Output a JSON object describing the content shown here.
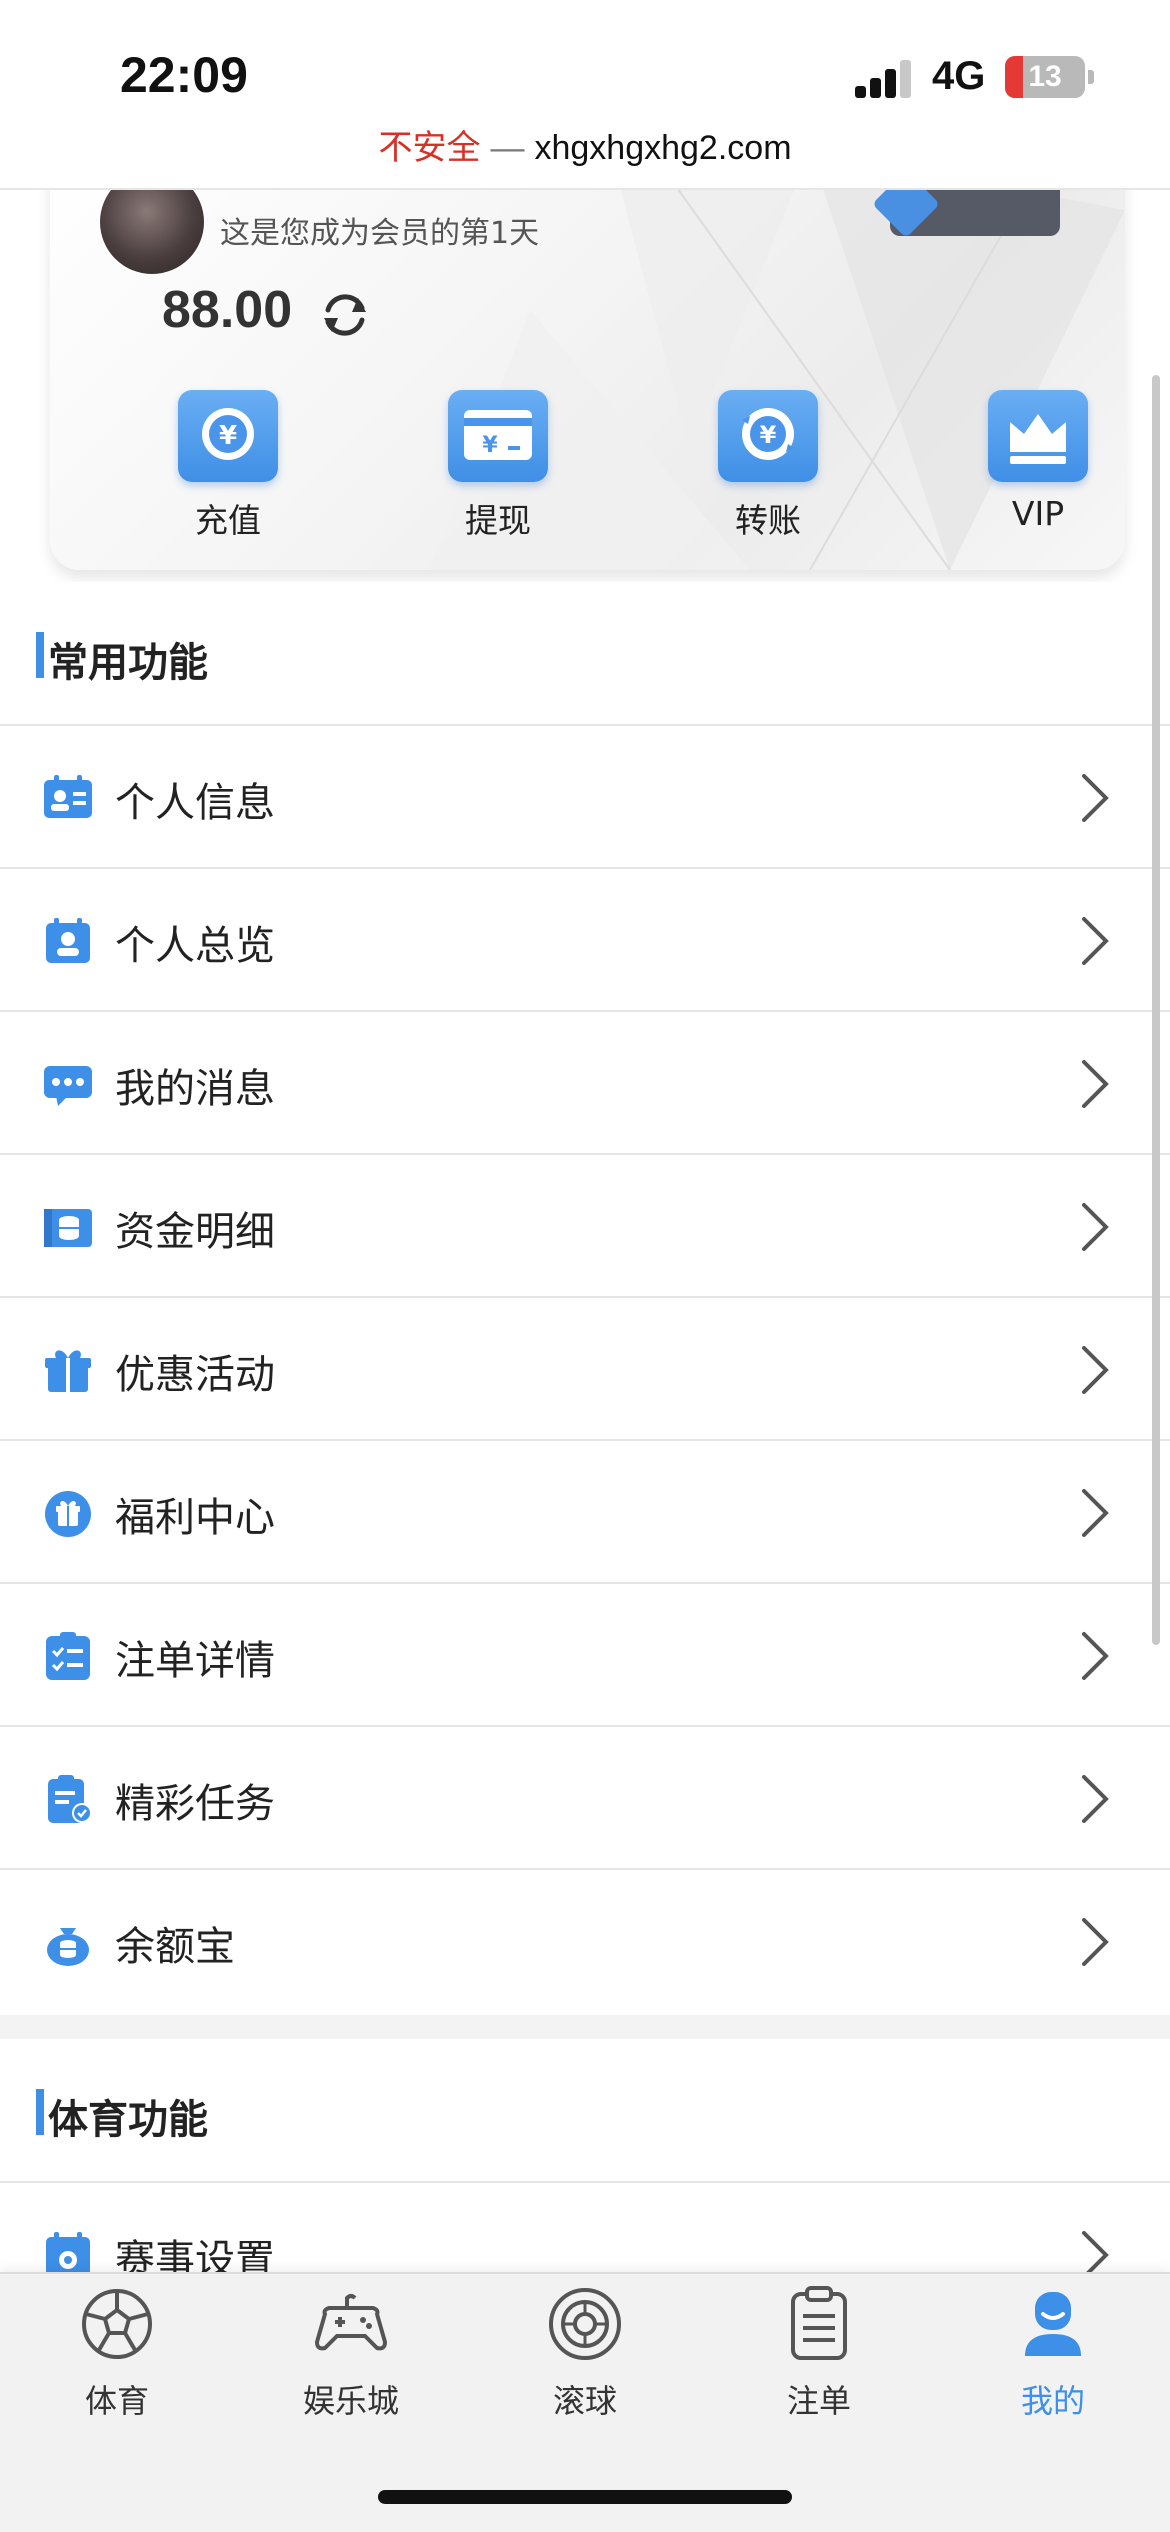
{
  "status_bar": {
    "time": "22:09",
    "network": "4G",
    "battery": "13",
    "insecure_label": "不安全",
    "separator": "—",
    "url": "xhgxhgxhg2.com"
  },
  "card": {
    "member_text": "这是您成为会员的第1天",
    "balance": "88.00",
    "actions": [
      {
        "label": "充值",
        "icon": "recharge-icon"
      },
      {
        "label": "提现",
        "icon": "withdraw-icon"
      },
      {
        "label": "转账",
        "icon": "transfer-icon"
      },
      {
        "label": "VIP",
        "icon": "crown-icon"
      }
    ]
  },
  "common_section": {
    "title": "常用功能",
    "items": [
      {
        "label": "个人信息",
        "icon": "id-card-icon"
      },
      {
        "label": "个人总览",
        "icon": "profile-icon"
      },
      {
        "label": "我的消息",
        "icon": "message-icon"
      },
      {
        "label": "资金明细",
        "icon": "funds-icon"
      },
      {
        "label": "优惠活动",
        "icon": "gift-icon"
      },
      {
        "label": "福利中心",
        "icon": "welfare-icon"
      },
      {
        "label": "注单详情",
        "icon": "checklist-icon"
      },
      {
        "label": "精彩任务",
        "icon": "task-icon"
      },
      {
        "label": "余额宝",
        "icon": "money-bag-icon"
      }
    ]
  },
  "sports_section": {
    "title": "体育功能",
    "items": [
      {
        "label": "赛事设置",
        "icon": "calendar-settings-icon"
      }
    ]
  },
  "tabbar": {
    "tabs": [
      {
        "label": "体育",
        "icon": "soccer-ball-icon"
      },
      {
        "label": "娱乐城",
        "icon": "gamepad-icon"
      },
      {
        "label": "滚球",
        "icon": "live-ball-icon"
      },
      {
        "label": "注单",
        "icon": "clipboard-icon"
      },
      {
        "label": "我的",
        "icon": "user-icon",
        "active": true
      }
    ]
  },
  "colors": {
    "accent": "#3d8fe8",
    "insecure": "#d93025"
  }
}
